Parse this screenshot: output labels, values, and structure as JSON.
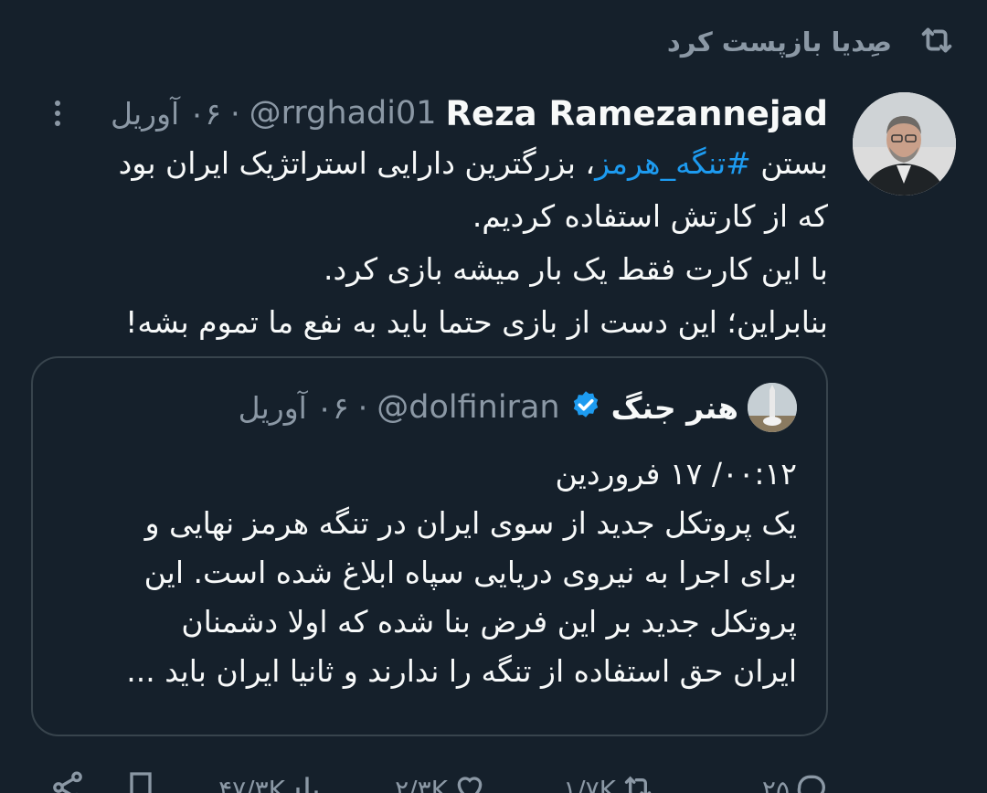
{
  "retweet": {
    "label": "صِدیا بازپست کرد",
    "icon": "retweet-icon"
  },
  "post": {
    "author_name": "Reza Ramezannejad",
    "handle": "@rrghadi01",
    "separator": "·",
    "time": "۰۶ آوریل",
    "body": {
      "line1_prefix": "بستن ",
      "line1_hashtag": "#تنگه_هرمز",
      "line1_suffix": "، بزرگترین دارایی استراتژیک ایران بود",
      "line2": "که از کارتش استفاده کردیم.",
      "line3": "با این کارت فقط یک بار میشه بازی کرد.",
      "line4": "بنابراین؛ این دست از بازی حتما باید به نفع ما تموم بشه!"
    }
  },
  "quoted": {
    "author_name": "هنر جنگ",
    "handle": "@dolfiniran",
    "separator": "·",
    "time": "۰۶ آوریل",
    "lines": [
      "۰۰:۱۲/ ۱۷ فروردین",
      "یک پروتکل جدید از سوی ایران در تنگه هرمز نهایی و",
      "برای اجرا به نیروی دریایی سپاه ابلاغ شده است. این",
      "پروتکل جدید بر این فرض بنا شده که اولا دشمنان",
      "ایران حق استفاده از تنگه را ندارند و ثانیا ایران باید ..."
    ]
  },
  "actions": {
    "replies": "۲۵",
    "reposts": "۱/۷K",
    "likes": "۲/۳K",
    "views": "۴۷/۳K"
  },
  "colors": {
    "background": "#15202b",
    "secondary_text": "#8b98a5",
    "link": "#1d9bf0",
    "border": "#38444d"
  }
}
